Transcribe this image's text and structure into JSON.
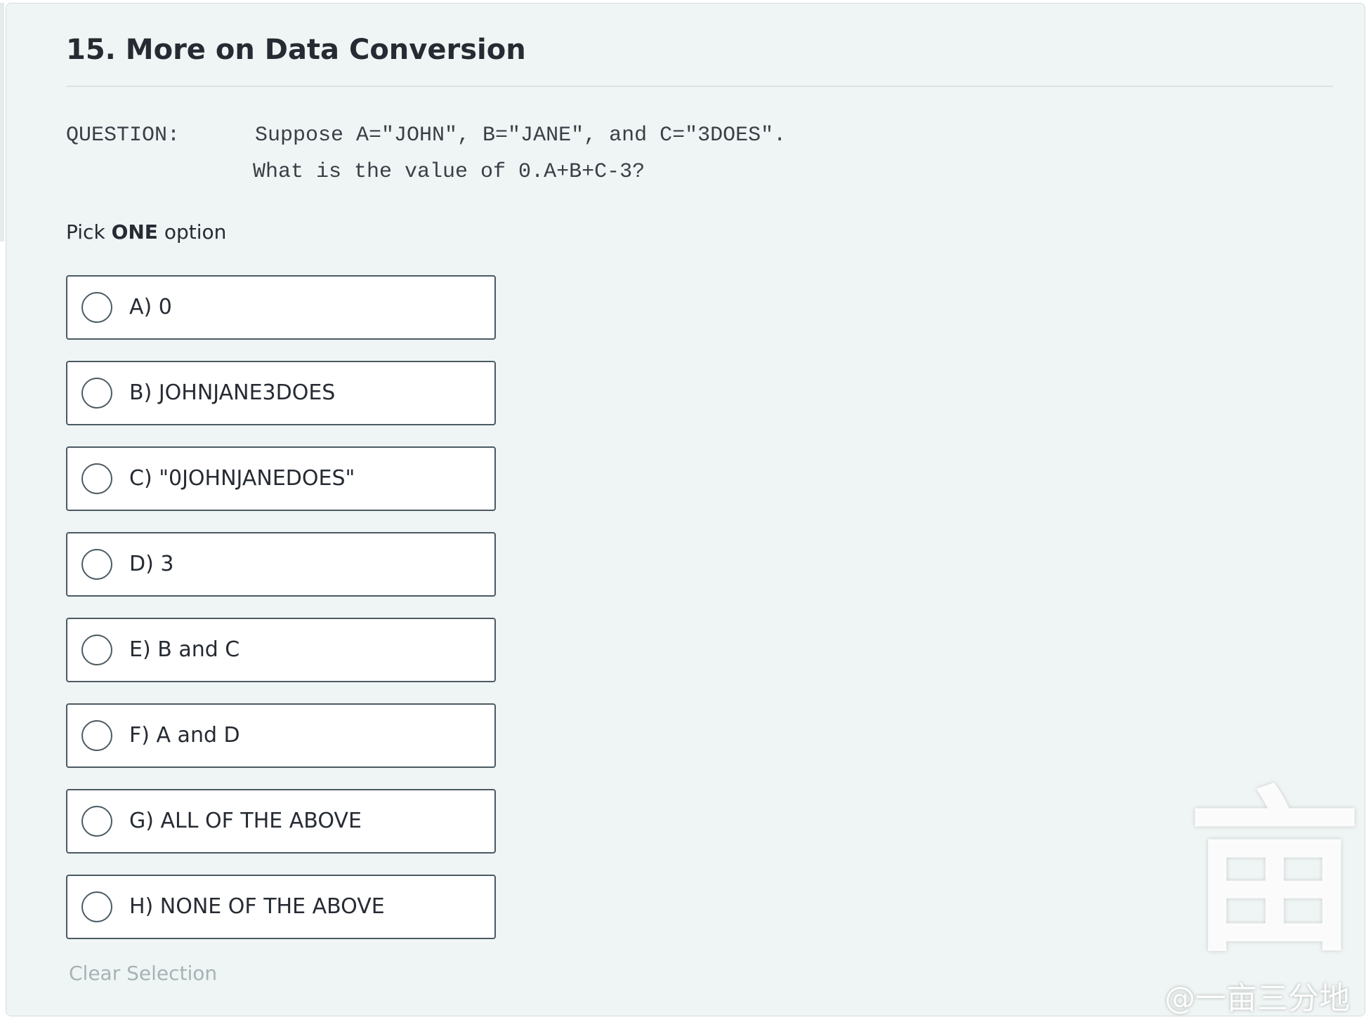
{
  "question": {
    "title": "15. More on Data Conversion",
    "label": "QUESTION:",
    "line1": "Suppose A=\"JOHN\", B=\"JANE\", and C=\"3DOES\".",
    "line2": "What is the value of 0.A+B+C-3?"
  },
  "instructions": {
    "prefix": "Pick ",
    "emphasis": "ONE",
    "suffix": " option"
  },
  "options": [
    {
      "label": "A) 0",
      "selected": false
    },
    {
      "label": "B) JOHNJANE3DOES",
      "selected": false
    },
    {
      "label": "C) \"0JOHNJANEDOES\"",
      "selected": false
    },
    {
      "label": "D) 3",
      "selected": false
    },
    {
      "label": "E) B and C",
      "selected": false
    },
    {
      "label": "F) A and D",
      "selected": false
    },
    {
      "label": "G) ALL OF THE ABOVE",
      "selected": false
    },
    {
      "label": "H) NONE OF THE ABOVE",
      "selected": false
    }
  ],
  "clear_selection_label": "Clear Selection",
  "watermark": {
    "glyph": "亩",
    "text": "@一亩三分地"
  },
  "colors": {
    "panel_background": "#eff5f4",
    "option_border": "#4b5a62",
    "title_text": "#262b33",
    "muted_link": "#a6b3b5"
  }
}
